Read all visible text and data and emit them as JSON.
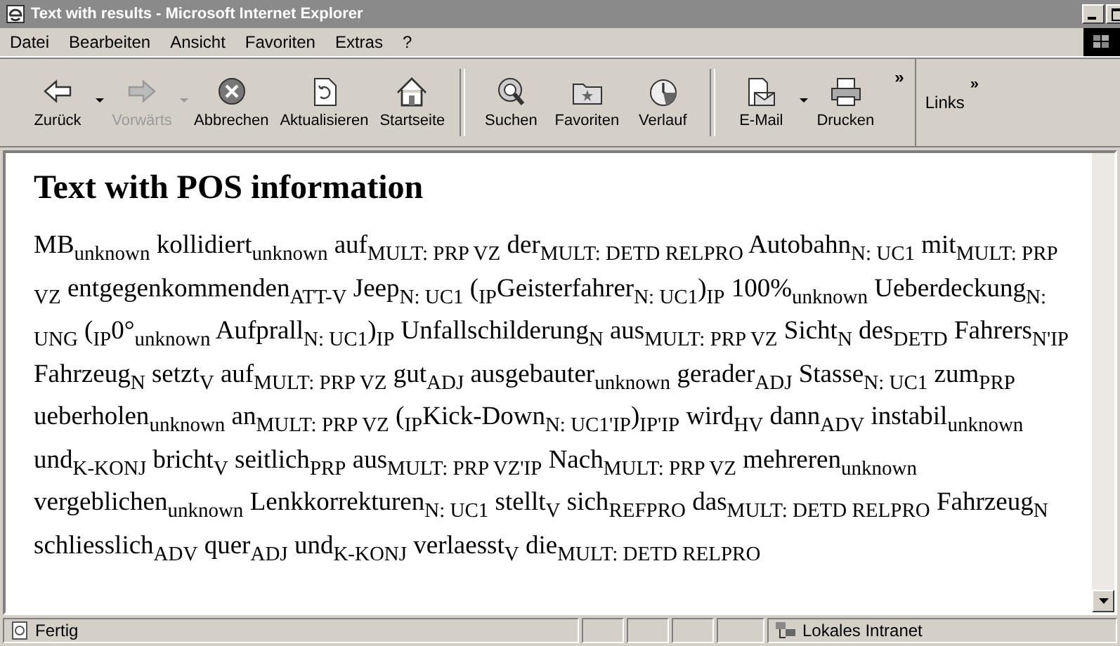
{
  "window": {
    "title": "Text with results - Microsoft Internet Explorer"
  },
  "menu": [
    "Datei",
    "Bearbeiten",
    "Ansicht",
    "Favoriten",
    "Extras",
    "?"
  ],
  "toolbar": {
    "groups": [
      [
        {
          "label": "Zurück",
          "disabled": false,
          "dropdown": true
        },
        {
          "label": "Vorwärts",
          "disabled": true,
          "dropdown": true
        },
        {
          "label": "Abbrechen",
          "disabled": false,
          "dropdown": false
        },
        {
          "label": "Aktualisieren",
          "disabled": false,
          "dropdown": false
        },
        {
          "label": "Startseite",
          "disabled": false,
          "dropdown": false
        }
      ],
      [
        {
          "label": "Suchen",
          "disabled": false,
          "dropdown": false
        },
        {
          "label": "Favoriten",
          "disabled": false,
          "dropdown": false
        },
        {
          "label": "Verlauf",
          "disabled": false,
          "dropdown": false
        }
      ],
      [
        {
          "label": "E-Mail",
          "disabled": false,
          "dropdown": true
        },
        {
          "label": "Drucken",
          "disabled": false,
          "dropdown": false
        }
      ]
    ],
    "more": "»",
    "links": "Links",
    "links_more": "»"
  },
  "page": {
    "heading": "Text with POS information",
    "text": "MB$_{unknown}$ kollidiert$_{unknown}$ auf$_{MULT: PRP VZ}$ der$_{MULT: DETD RELPRO}$ Autobahn$_{N: UC1}$ mit$_{MULT: PRP VZ}$ entgegenkommenden$_{ATT-V}$ Jeep$_{N: UC1}$ ($_{IP}$Geisterfahrer$_{N: UC1}$)$_{IP}$ 100%$_{unknown}$ Ueberdeckung$_{N: UNG}$ ($_{IP}$0°$_{unknown}$ Aufprall$_{N: UC1}$)$_{IP}$ Unfallschilderung$_{N}$ aus$_{MULT: PRP VZ}$ Sicht$_{N}$ des$_{DETD}$ Fahrers$_{N'IP}$ Fahrzeug$_{N}$ setzt$_{V}$ auf$_{MULT: PRP VZ}$ gut$_{ADJ}$ ausgebauter$_{unknown}$ gerader$_{ADJ}$ Stasse$_{N: UC1}$ zum$_{PRP}$ ueberholen$_{unknown}$ an$_{MULT: PRP VZ}$ ($_{IP}$Kick-Down$_{N: UC1'IP}$)$_{IP'IP}$ wird$_{HV}$ dann$_{ADV}$ instabil$_{unknown}$ und$_{K-KONJ}$ bricht$_{V}$ seitlich$_{PRP}$ aus$_{MULT: PRP VZ'IP}$ Nach$_{MULT: PRP VZ}$ mehreren$_{unknown}$ vergeblichen$_{unknown}$ Lenkkorrekturen$_{N: UC1}$ stellt$_{V}$ sich$_{REFPRO}$ das$_{MULT: DETD RELPRO}$ Fahrzeug$_{N}$ schliesslich$_{ADV}$ quer$_{ADJ}$ und$_{K-KONJ}$ verlaesst$_{V}$ die$_{MULT: DETD RELPRO}$"
  },
  "status_bar": {
    "text": "Fertig",
    "zone": "Lokales Intranet"
  }
}
